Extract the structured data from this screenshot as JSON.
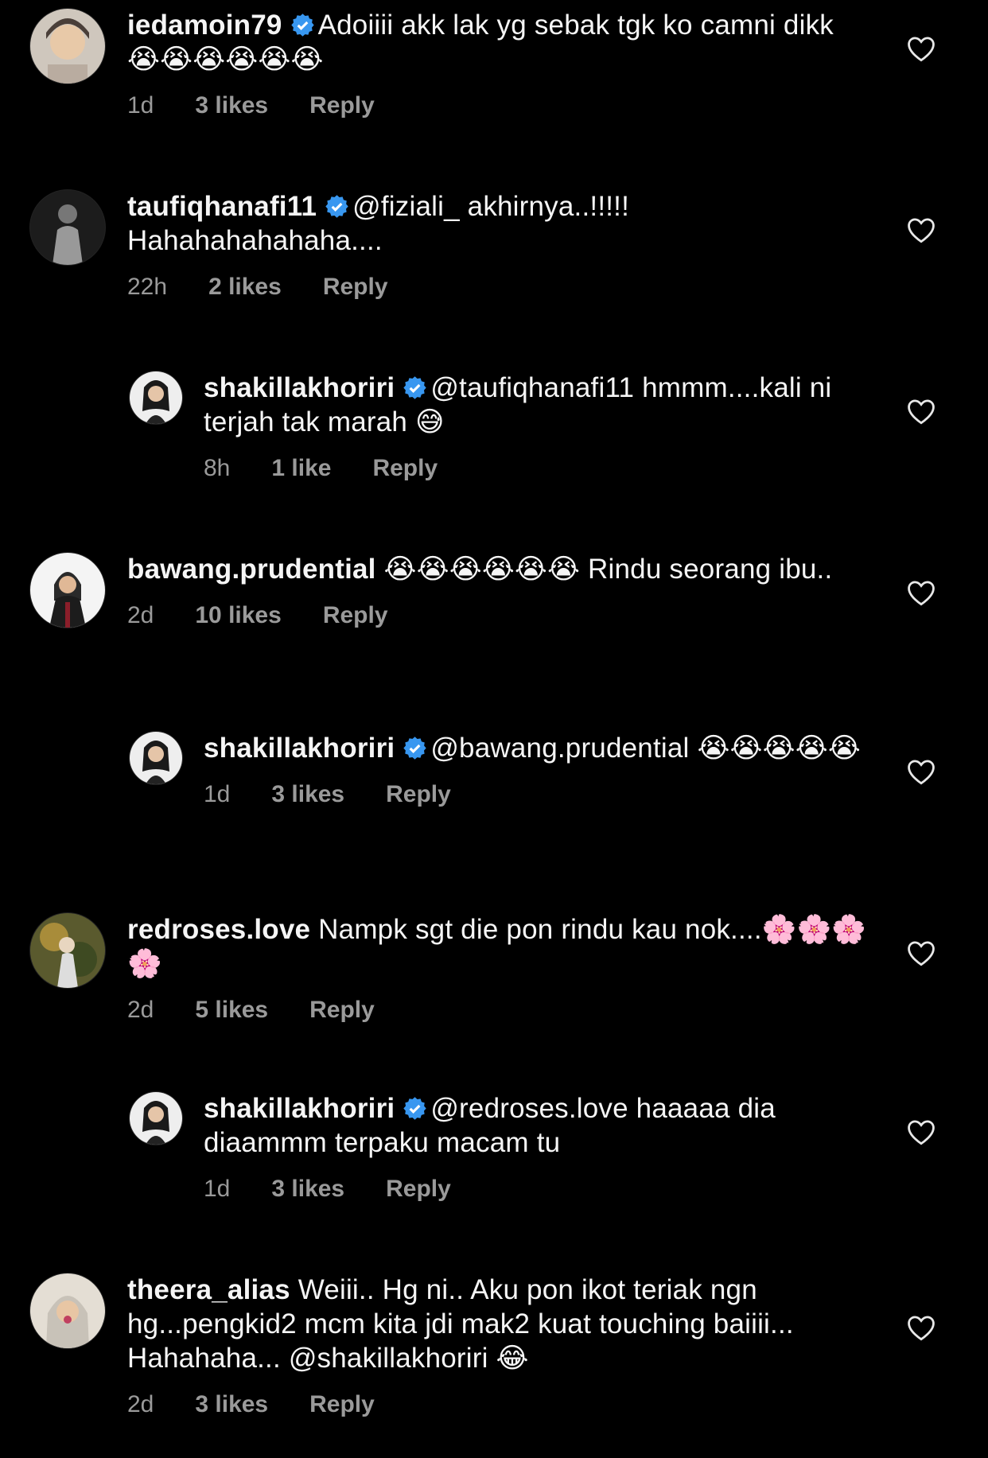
{
  "comments": [
    {
      "username": "iedamoin79",
      "verified": true,
      "text": "Adoiiii akk lak yg sebak tgk ko camni dikk",
      "line_break_after": "camni",
      "trail_emoji": "😭😭😭😭😭😭",
      "time": "1d",
      "likes": "3 likes",
      "reply": "Reply",
      "indent": false,
      "avatar_color": "#b8aa9c"
    },
    {
      "username": "taufiqhanafi11",
      "verified": true,
      "text": "@fiziali_ akhirnya..!!!!! Hahahahahahaha....",
      "time": "22h",
      "likes": "2 likes",
      "reply": "Reply",
      "indent": false,
      "avatar_color": "#3b3b3b"
    },
    {
      "username": "shakillakhoriri",
      "verified": true,
      "text": "@taufiqhanafi11 hmmm....kali ni terjah tak marah",
      "trail_emoji": "😅",
      "time": "8h",
      "likes": "1 like",
      "reply": "Reply",
      "indent": true,
      "avatar_color": "#dcdcdc"
    },
    {
      "username": "bawang.prudential",
      "verified": false,
      "lead_emoji": "😭😭😭😭😭😭",
      "text": "Rindu seorang ibu..",
      "time": "2d",
      "likes": "10 likes",
      "reply": "Reply",
      "indent": false,
      "avatar_color": "#f2f2f2"
    },
    {
      "username": "shakillakhoriri",
      "verified": true,
      "text": "@bawang.prudential",
      "trail_emoji": "😭😭😭😭😭",
      "time": "1d",
      "likes": "3 likes",
      "reply": "Reply",
      "indent": true,
      "avatar_color": "#dcdcdc"
    },
    {
      "username": "redroses.love",
      "verified": false,
      "text": "Nampk sgt die pon rindu kau nok....",
      "trail_emoji": "🌸🌸🌸🌸",
      "time": "2d",
      "likes": "5 likes",
      "reply": "Reply",
      "indent": false,
      "avatar_color": "#6b6a3a"
    },
    {
      "username": "shakillakhoriri",
      "verified": true,
      "text": "@redroses.love haaaaa dia diaammm terpaku macam tu",
      "time": "1d",
      "likes": "3 likes",
      "reply": "Reply",
      "indent": true,
      "avatar_color": "#dcdcdc"
    },
    {
      "username": "theera_alias",
      "verified": false,
      "text": "Weiii.. Hg ni.. Aku pon ikot teriak ngn hg...pengkid2 mcm kita jdi mak2 kuat touching baiiii... Hahahaha... @shakillakhoriri",
      "trail_emoji": "😂",
      "time": "2d",
      "likes": "3 likes",
      "reply": "Reply",
      "indent": false,
      "avatar_color": "#d8d2c8"
    }
  ],
  "colors": {
    "background": "#000000",
    "text": "#f5f5f5",
    "meta": "#9a9a9a",
    "verified": "#3897f0"
  },
  "icons": {
    "verified": "verified-badge-icon",
    "like": "heart-outline-icon"
  }
}
